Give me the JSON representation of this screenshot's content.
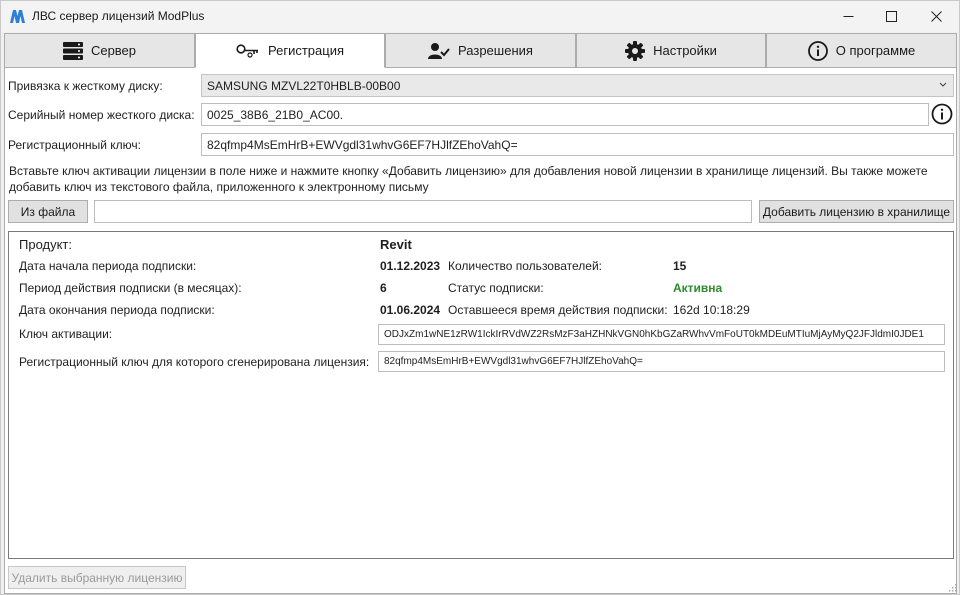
{
  "window": {
    "title": "ЛВС сервер лицензий ModPlus",
    "brand_color": "#2f7fd4"
  },
  "tabs": [
    {
      "label": "Сервер",
      "icon": "server-icon",
      "active": false
    },
    {
      "label": "Регистрация",
      "icon": "key-icon",
      "active": true
    },
    {
      "label": "Разрешения",
      "icon": "user-check-icon",
      "active": false
    },
    {
      "label": "Настройки",
      "icon": "gear-icon",
      "active": false
    },
    {
      "label": "О программе",
      "icon": "info-icon",
      "active": false
    }
  ],
  "registration": {
    "disk_binding_label": "Привязка к жесткому диску:",
    "disk_binding_value": "SAMSUNG MZVL22T0HBLB-00B00",
    "serial_label": "Серийный номер жесткого диска:",
    "serial_value": "0025_38B6_21B0_AC00.",
    "regkey_label": "Регистрационный ключ:",
    "regkey_value": "82qfmp4MsEmHrB+EWVgdl31whvG6EF7HJlfZEhoVahQ=",
    "hint": "Вставьте ключ активации лицензии в поле ниже и нажмите кнопку «Добавить лицензию» для добавления новой лицензии в хранилище лицензий. Вы также можете добавить ключ из текстового файла, приложенного к электронному письму",
    "from_file_button": "Из файла",
    "activation_input_value": "",
    "add_license_button": "Добавить лицензию в хранилище"
  },
  "license": {
    "product_label": "Продукт:",
    "product_value": "Revit",
    "start_label": "Дата начала периода подписки:",
    "start_value": "01.12.2023",
    "users_label": "Количество пользователей:",
    "users_value": "15",
    "period_label": "Период действия подписки (в месяцах):",
    "period_value": "6",
    "status_label": "Статус подписки:",
    "status_value": "Активна",
    "status_color": "#2e8b2e",
    "end_label": "Дата окончания периода подписки:",
    "end_value": "01.06.2024",
    "remaining_label": "Оставшееся время действия подписки:",
    "remaining_value": "162d 10:18:29",
    "activation_key_label": "Ключ активации:",
    "activation_key_value": "ODJxZm1wNE1zRW1IckIrRVdWZ2RsMzF3aHZHNkVGN0hKbGZaRWhvVmFoUT0kMDEuMTIuMjAyMyQ2JFJldmI0JDE1",
    "generated_for_label": "Регистрационный ключ для которого сгенерирована лицензия:",
    "generated_for_value": "82qfmp4MsEmHrB+EWVgdl31whvG6EF7HJlfZEhoVahQ="
  },
  "footer": {
    "delete_button": "Удалить выбранную лицензию"
  }
}
